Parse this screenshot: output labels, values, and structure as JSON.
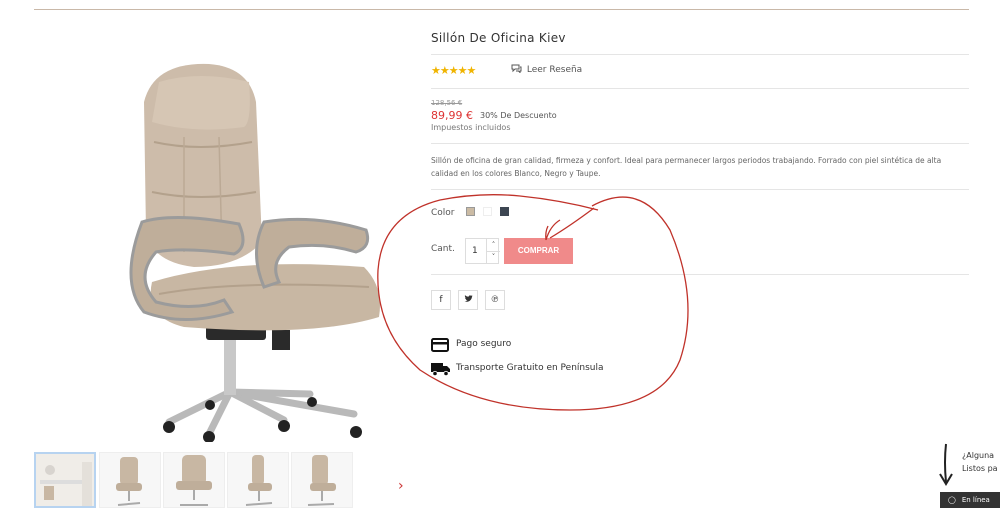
{
  "product": {
    "title": "Sillón De Oficina Kiev",
    "stars": "★★★★★",
    "review_link": "Leer Reseña",
    "old_price": "128,56 €",
    "price": "89,99 €",
    "discount": "30% De Descuento",
    "tax_note": "Impuestos incluidos",
    "description": "Sillón de oficina de gran calidad, firmeza y confort. Ideal para permanecer largos periodos trabajando. Forrado con piel sintética de alta calidad en los colores Blanco, Negro y Taupe."
  },
  "options": {
    "color_label": "Color",
    "colors": [
      "#cbbba4",
      "#ffffff",
      "#3d4652"
    ],
    "qty_label": "Cant.",
    "qty_value": "1",
    "buy_label": "COMPRAR"
  },
  "social": [
    "facebook-icon",
    "twitter-icon",
    "pinterest-icon"
  ],
  "features": {
    "payment": "Pago seguro",
    "shipping": "Transporte Gratuito en Península"
  },
  "chat": {
    "note_line1": "¿Alguna",
    "note_line2": "Listos pa",
    "status": "En línea"
  },
  "colors": {
    "accent": "#f08a8a",
    "price": "#dd3333",
    "annotation": "#c0322a"
  }
}
